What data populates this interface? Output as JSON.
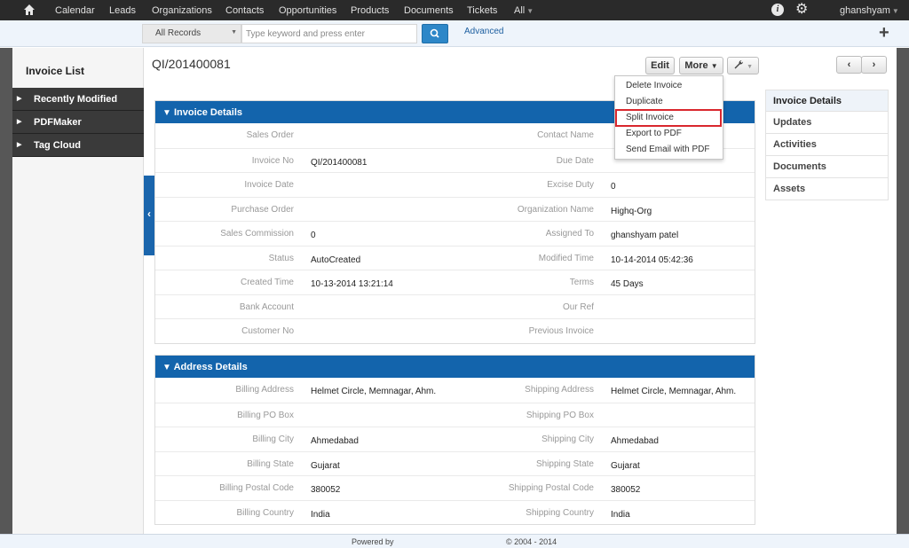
{
  "nav": {
    "items": [
      "Calendar",
      "Leads",
      "Organizations",
      "Contacts",
      "Opportunities",
      "Products",
      "Documents",
      "Tickets",
      "All"
    ],
    "user": "ghanshyam"
  },
  "search": {
    "scope": "All Records",
    "placeholder": "Type keyword and press enter",
    "advanced": "Advanced"
  },
  "sidebar": {
    "title": "Invoice List",
    "items": [
      "Recently Modified",
      "PDFMaker",
      "Tag Cloud"
    ]
  },
  "record": {
    "title": "QI/201400081",
    "edit_label": "Edit",
    "more_label": "More"
  },
  "more_menu": [
    "Delete Invoice",
    "Duplicate",
    "Split Invoice",
    "Export to PDF",
    "Send Email with PDF"
  ],
  "invoice_details": {
    "header": "Invoice Details",
    "rows": [
      {
        "l1": "Sales Order",
        "v1": "",
        "l2": "Contact Name",
        "v2": ""
      },
      {
        "l1": "Invoice No",
        "v1": "QI/201400081",
        "l2": "Due Date",
        "v2": ""
      },
      {
        "l1": "Invoice Date",
        "v1": "",
        "l2": "Excise Duty",
        "v2": "0"
      },
      {
        "l1": "Purchase Order",
        "v1": "",
        "l2": "Organization Name",
        "v2": "Highq-Org"
      },
      {
        "l1": "Sales Commission",
        "v1": "0",
        "l2": "Assigned To",
        "v2": "ghanshyam patel"
      },
      {
        "l1": "Status",
        "v1": "AutoCreated",
        "l2": "Modified Time",
        "v2": "10-14-2014 05:42:36"
      },
      {
        "l1": "Created Time",
        "v1": "10-13-2014 13:21:14",
        "l2": "Terms",
        "v2": "45 Days"
      },
      {
        "l1": "Bank Account",
        "v1": "",
        "l2": "Our Ref",
        "v2": ""
      },
      {
        "l1": "Customer No",
        "v1": "",
        "l2": "Previous Invoice",
        "v2": ""
      }
    ]
  },
  "address_details": {
    "header": "Address Details",
    "rows": [
      {
        "l1": "Billing Address",
        "v1": "Helmet Circle, Memnagar, Ahm.",
        "l2": "Shipping Address",
        "v2": "Helmet Circle, Memnagar, Ahm."
      },
      {
        "l1": "Billing PO Box",
        "v1": "",
        "l2": "Shipping PO Box",
        "v2": ""
      },
      {
        "l1": "Billing City",
        "v1": "Ahmedabad",
        "l2": "Shipping City",
        "v2": "Ahmedabad"
      },
      {
        "l1": "Billing State",
        "v1": "Gujarat",
        "l2": "Shipping State",
        "v2": "Gujarat"
      },
      {
        "l1": "Billing Postal Code",
        "v1": "380052",
        "l2": "Shipping Postal Code",
        "v2": "380052"
      },
      {
        "l1": "Billing Country",
        "v1": "India",
        "l2": "Shipping Country",
        "v2": "India"
      }
    ]
  },
  "right_panel": [
    "Invoice Details",
    "Updates",
    "Activities",
    "Documents",
    "Assets"
  ],
  "footer": {
    "powered": "Powered by",
    "copyright": "© 2004 - 2014"
  },
  "colors": {
    "accent": "#1364ac",
    "nav_bg": "#2a2a2a",
    "highlight": "#d9272e"
  }
}
